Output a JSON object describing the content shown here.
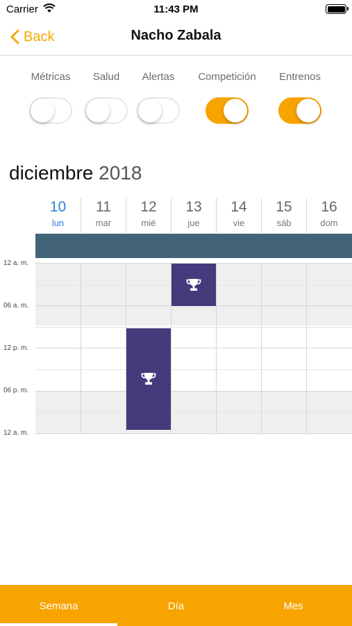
{
  "status_bar": {
    "carrier": "Carrier",
    "time": "11:43 PM",
    "wifi_icon": "wifi-icon",
    "battery_icon": "battery-icon"
  },
  "nav": {
    "back_label": "Back",
    "back_icon": "chevron-left-icon",
    "title": "Nacho Zabala"
  },
  "toggles": [
    {
      "label": "Métricas",
      "on": false
    },
    {
      "label": "Salud",
      "on": false
    },
    {
      "label": "Alertas",
      "on": false
    },
    {
      "label": "Competición",
      "on": true
    },
    {
      "label": "Entrenos",
      "on": true
    }
  ],
  "calendar": {
    "month": "diciembre",
    "year": "2018",
    "days": [
      {
        "num": "10",
        "name": "lun",
        "today": true
      },
      {
        "num": "11",
        "name": "mar",
        "today": false
      },
      {
        "num": "12",
        "name": "mié",
        "today": false
      },
      {
        "num": "13",
        "name": "jue",
        "today": false
      },
      {
        "num": "14",
        "name": "vie",
        "today": false
      },
      {
        "num": "15",
        "name": "sáb",
        "today": false
      },
      {
        "num": "16",
        "name": "dom",
        "today": false
      }
    ],
    "time_labels": [
      "12 a. m.",
      "06 a. m.",
      "12 p. m.",
      "06 p. m.",
      "12 a. m."
    ],
    "events": [
      {
        "day": "13",
        "icon": "trophy-icon"
      },
      {
        "day": "12",
        "icon": "trophy-icon"
      }
    ]
  },
  "tabs": [
    {
      "label": "Semana",
      "active": true
    },
    {
      "label": "Día",
      "active": false
    },
    {
      "label": "Mes",
      "active": false
    }
  ],
  "colors": {
    "accent": "#f7a300",
    "today": "#2f7fd9",
    "allday_bar": "#436478",
    "event": "#453a7c"
  }
}
